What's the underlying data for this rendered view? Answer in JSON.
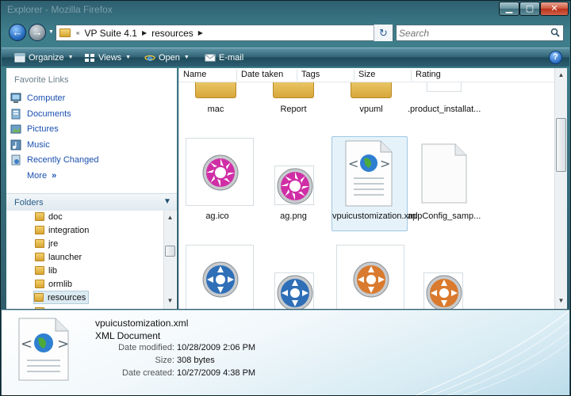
{
  "window": {
    "title": "Explorer - Mozilla Firefox",
    "controls": {
      "minimize": "▁",
      "maximize": "▢",
      "close": "✕"
    }
  },
  "address": {
    "nav_prefix": "«",
    "crumbs": [
      "VP Suite 4.1",
      "resources"
    ],
    "refresh_symbol": "↻",
    "search_placeholder": "Search"
  },
  "toolbar": {
    "organize_label": "Organize",
    "views_label": "Views",
    "open_label": "Open",
    "email_label": "E-mail",
    "help_label": "?"
  },
  "navigation": {
    "favorites_header": "Favorite Links",
    "favorites": [
      "Computer",
      "Documents",
      "Pictures",
      "Music",
      "Recently Changed"
    ],
    "more_label": "More",
    "more_arrows": "»",
    "folders_header": "Folders",
    "tree": [
      "doc",
      "integration",
      "jre",
      "launcher",
      "lib",
      "ormlib",
      "resources"
    ],
    "selected_folder": "resources"
  },
  "columns": [
    "Name",
    "Date taken",
    "Tags",
    "Size",
    "Rating"
  ],
  "files": {
    "row1": [
      "mac",
      "Report",
      "vpuml",
      ".product_installat..."
    ],
    "row2": [
      "ag.ico",
      "ag.png",
      "vpuicustomization.xml",
      "appConfig_samp..."
    ],
    "selected": "vpuicustomization.xml"
  },
  "details": {
    "name": "vpuicustomization.xml",
    "type": "XML Document",
    "date_modified_label": "Date modified:",
    "date_modified": "10/28/2009 2:06 PM",
    "size_label": "Size:",
    "size": "308 bytes",
    "date_created_label": "Date created:",
    "date_created": "10/27/2009 4:38 PM"
  },
  "colors": {
    "accent": "#1a4fb0",
    "selection": "#e6f2fa",
    "chrome": "#2f6173"
  }
}
